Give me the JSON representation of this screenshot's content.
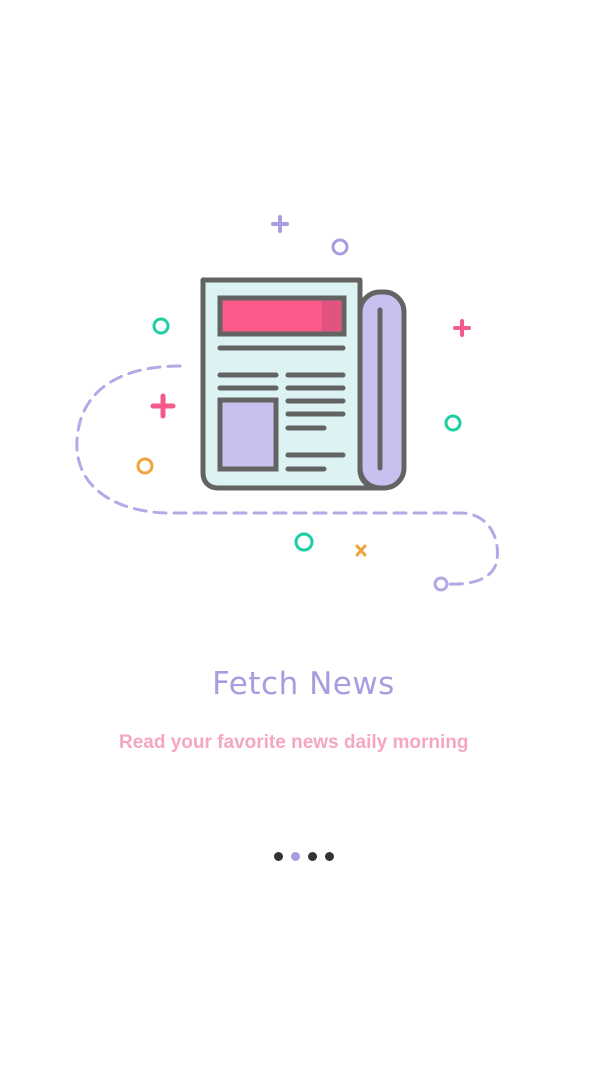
{
  "onboarding": {
    "title": "Fetch News",
    "subtitle": "Read your favorite news daily morning",
    "illustration_icon": "newspaper-icon",
    "pager": {
      "total": 4,
      "active_index": 1
    }
  },
  "colors": {
    "title": "#a79de0",
    "subtitle": "#f5a6c0",
    "dot_inactive": "#333333",
    "dot_active": "#a79de0",
    "accent_pink": "#f45b8b",
    "accent_teal": "#1dcfa3",
    "accent_orange": "#f1a33c",
    "accent_lavender": "#a79de0"
  }
}
